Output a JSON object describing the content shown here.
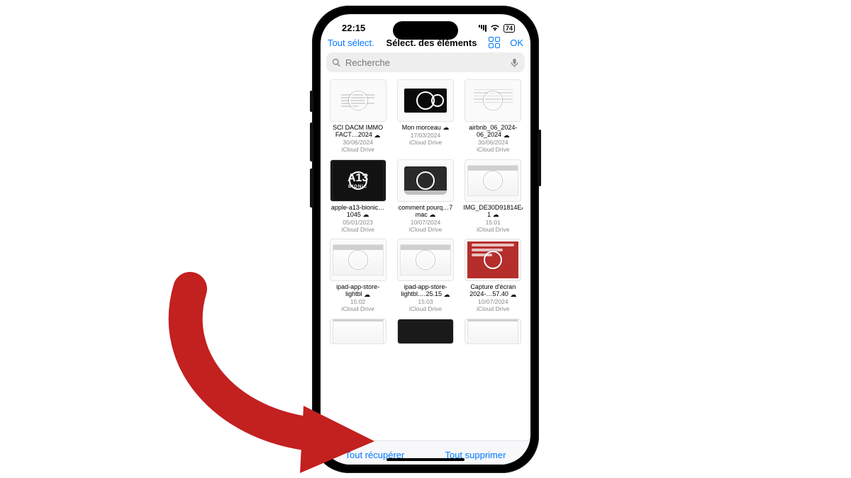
{
  "status": {
    "time": "22:15",
    "battery": "74"
  },
  "nav": {
    "back_label": "Tout sélect.",
    "title": "Sélect. des éléments",
    "ok_label": "OK"
  },
  "search": {
    "placeholder": "Recherche"
  },
  "files": [
    {
      "name": "SCI DACM IMMO FACT…2024",
      "date": "30/06/2024",
      "loc": "iCloud Drive",
      "kind": "doc"
    },
    {
      "name": "Mon morceau",
      "date": "17/03/2024",
      "loc": "iCloud Drive",
      "kind": "garage"
    },
    {
      "name": "airbnb_06_2024-06_2024",
      "date": "30/06/2024",
      "loc": "iCloud Drive",
      "kind": "table"
    },
    {
      "name": "apple-a13-bionic…1045",
      "date": "05/01/2023",
      "loc": "iCloud Drive",
      "kind": "a13"
    },
    {
      "name": "comment pourq…7 mac",
      "date": "10/07/2024",
      "loc": "iCloud Drive",
      "kind": "mac"
    },
    {
      "name": "IMG_DE30D91814EA-1",
      "date": "15:01",
      "loc": "iCloud Drive",
      "kind": "shot"
    },
    {
      "name": "ipad-app-store-lightbl",
      "date": "15:02",
      "loc": "iCloud Drive",
      "kind": "shot"
    },
    {
      "name": "ipad-app-store-lightbl.…25.15",
      "date": "15:03",
      "loc": "iCloud Drive",
      "kind": "shot"
    },
    {
      "name": "Capture d'écran 2024-…57.40",
      "date": "10/07/2024",
      "loc": "iCloud Drive",
      "kind": "red"
    }
  ],
  "bottom": {
    "recover_label": "Tout récupérer",
    "delete_label": "Tout supprimer"
  },
  "arrow": {
    "color": "#c32020"
  }
}
